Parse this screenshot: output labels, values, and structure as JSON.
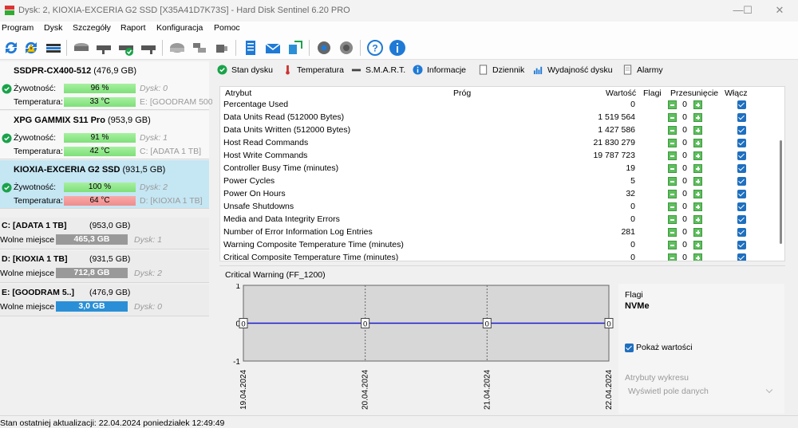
{
  "window": {
    "title": "Dysk: 2, KIOXIA-EXCERIA G2 SSD [X35A41D7K73S]  -  Hard Disk Sentinel 6.20 PRO",
    "minimize": "—",
    "maximize": "☐",
    "close": "✕"
  },
  "menu": {
    "items": [
      {
        "label": "Program",
        "underline": "P"
      },
      {
        "label": "Dysk",
        "underline": "D"
      },
      {
        "label": "Szczegóły",
        "underline": "z"
      },
      {
        "label": "Raport",
        "underline": "R"
      },
      {
        "label": "Konfiguracja",
        "underline": "K"
      },
      {
        "label": "Pomoc",
        "underline": "P"
      }
    ]
  },
  "toolbar": {
    "icons": [
      "refresh-icon",
      "refresh-warning-icon",
      "disk-icon",
      "disk-drive-icon",
      "disk-drive-detail-icon",
      "disk-ok-icon",
      "disk-search-icon",
      "disk-gray-icon",
      "disk-network-icon",
      "usb-drive-icon",
      "report-icon",
      "email-icon",
      "export-icon",
      "settings-icon",
      "sound-icon",
      "help-icon",
      "info-icon"
    ]
  },
  "disks": [
    {
      "name": "SSDPR-CX400-512",
      "size": "(476,9 GB)",
      "health_label": "Żywotność:",
      "health_value": "96 %",
      "health_percent": 96,
      "disk_label": "Dysk: 0",
      "temp_label": "Temperatura:",
      "temp_value": "33 °C",
      "temp_color": "green",
      "partition": "E: [GOODRAM 500",
      "selected": false
    },
    {
      "name": "XPG GAMMIX S11 Pro",
      "size": "(953,9 GB)",
      "health_label": "Żywotność:",
      "health_value": "91 %",
      "health_percent": 91,
      "disk_label": "Dysk: 1",
      "temp_label": "Temperatura:",
      "temp_value": "42 °C",
      "temp_color": "green",
      "partition": "C: [ADATA 1 TB]",
      "selected": false
    },
    {
      "name": "KIOXIA-EXCERIA G2 SSD",
      "size": "(931,5 GB)",
      "health_label": "Żywotność:",
      "health_value": "100 %",
      "health_percent": 100,
      "disk_label": "Dysk: 2",
      "temp_label": "Temperatura:",
      "temp_value": "64 °C",
      "temp_color": "red",
      "partition": "D: [KIOXIA 1 TB]",
      "selected": true
    }
  ],
  "volumes": [
    {
      "name": "C: [ADATA 1 TB]",
      "size": "(953,0 GB)",
      "free_label": "Wolne miejsce",
      "free_value": "465,3 GB",
      "bar_color": "#999999",
      "disk": "Dysk: 1"
    },
    {
      "name": "D: [KIOXIA 1 TB]",
      "size": "(931,5 GB)",
      "free_label": "Wolne miejsce",
      "free_value": "712,8 GB",
      "bar_color": "#999999",
      "disk": "Dysk: 2"
    },
    {
      "name": "E: [GOODRAM 5..]",
      "size": "(476,9 GB)",
      "free_label": "Wolne miejsce",
      "free_value": "3,0 GB",
      "bar_color": "#2a8fd6",
      "disk": "Dysk: 0"
    }
  ],
  "tabs": [
    {
      "label": "Stan dysku",
      "icon": "check-circle-icon"
    },
    {
      "label": "Temperatura",
      "icon": "thermometer-icon"
    },
    {
      "label": "S.M.A.R.T.",
      "icon": "smart-bar-icon"
    },
    {
      "label": "Informacje",
      "icon": "info-icon"
    },
    {
      "label": "Dziennik",
      "icon": "document-icon"
    },
    {
      "label": "Wydajność dysku",
      "icon": "performance-chart-icon"
    },
    {
      "label": "Alarmy",
      "icon": "alarm-document-icon"
    }
  ],
  "smart_table": {
    "headers": {
      "attribute": "Atrybut",
      "threshold": "Próg",
      "value": "Wartość",
      "flags": "Flagi",
      "shift": "Przesunięcie",
      "enable": "Włącz"
    },
    "rows": [
      {
        "name": "Percentage Used",
        "value": "0",
        "shift": "0"
      },
      {
        "name": "Data Units Read (512000 Bytes)",
        "value": "1 519 564",
        "shift": "0"
      },
      {
        "name": "Data Units Written (512000 Bytes)",
        "value": "1 427 586",
        "shift": "0"
      },
      {
        "name": "Host Read Commands",
        "value": "21 830 279",
        "shift": "0"
      },
      {
        "name": "Host Write Commands",
        "value": "19 787 723",
        "shift": "0"
      },
      {
        "name": "Controller Busy Time (minutes)",
        "value": "19",
        "shift": "0"
      },
      {
        "name": "Power Cycles",
        "value": "5",
        "shift": "0"
      },
      {
        "name": "Power On Hours",
        "value": "32",
        "shift": "0"
      },
      {
        "name": "Unsafe Shutdowns",
        "value": "0",
        "shift": "0"
      },
      {
        "name": "Media and Data Integrity Errors",
        "value": "0",
        "shift": "0"
      },
      {
        "name": "Number of Error Information Log Entries",
        "value": "281",
        "shift": "0"
      },
      {
        "name": "Warning Composite Temperature Time (minutes)",
        "value": "0",
        "shift": "0"
      },
      {
        "name": "Critical Composite Temperature Time (minutes)",
        "value": "0",
        "shift": "0"
      }
    ]
  },
  "chart_title": "Critical Warning (FF_1200)",
  "chart_data": {
    "type": "line",
    "title": "Critical Warning (FF_1200)",
    "x": [
      "19.04.2024",
      "20.04.2024",
      "21.04.2024",
      "22.04.2024"
    ],
    "series": [
      {
        "values": [
          0,
          0,
          0,
          0
        ]
      }
    ],
    "ylim": [
      -1,
      1
    ],
    "yticks": [
      "1",
      "0",
      "-1"
    ],
    "data_labels": [
      "0",
      "0",
      "0",
      "0"
    ],
    "line_color": "#1a1acc",
    "grid": true
  },
  "flags_panel": {
    "flags_label": "Flagi",
    "flags_value": "NVMe",
    "show_values_label": "Pokaż wartości",
    "chart_attributes_label": "Atrybuty wykresu",
    "chart_attributes_value": "Wyświetl pole danych"
  },
  "status": {
    "text": "Stan ostatniej aktualizacji: 22.04.2024 poniedziałek 12:49:49"
  }
}
